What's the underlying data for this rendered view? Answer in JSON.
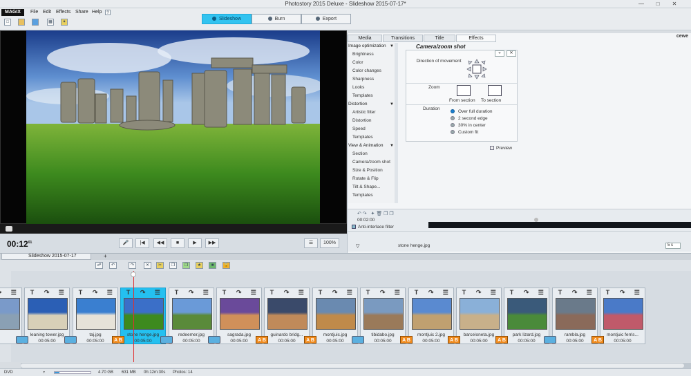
{
  "window": {
    "title": "Photostory 2015 Deluxe - Slideshow 2015-07-17*"
  },
  "menu": {
    "logo": "MAGIX",
    "items": [
      "File",
      "Edit",
      "Effects",
      "Share",
      "Help"
    ]
  },
  "modes": {
    "slideshow": "Slideshow",
    "burn": "Burn",
    "export": "Export"
  },
  "transport": {
    "time": "00:12",
    "frames": "01",
    "zoom": "100%"
  },
  "tabs": {
    "media": "Media",
    "transitions": "Transitions",
    "title": "Title",
    "effects": "Effects",
    "brand": "cewe"
  },
  "categories": {
    "image_opt": "Image optimization",
    "image_opt_items": [
      "Brightness",
      "Color",
      "Color changes",
      "Sharpness",
      "Looks",
      "Templates"
    ],
    "distortion": "Distortion",
    "distortion_items": [
      "Artistic filter",
      "Distortion",
      "Speed",
      "Templates"
    ],
    "view": "View & Animation",
    "view_items": [
      "Section",
      "Camera/zoom shot",
      "Size & Position",
      "Rotate & Flip",
      "Tilt & Shape...",
      "Templates"
    ]
  },
  "camera": {
    "title": "Camera/zoom shot",
    "direction_label": "Direction of movement",
    "zoom_label": "Zoom",
    "from_section": "From section",
    "to_section": "To section",
    "duration_label": "Duration",
    "options": [
      "Over full duration",
      "2 second edge",
      "30% in center",
      "Custom fit"
    ],
    "selected_option": "Over full duration",
    "preview_label": "Preview"
  },
  "panel_bottom": {
    "time": "00:02:00",
    "anti_interlace": "Anti-interlace filter",
    "file": "stone henge.jpg",
    "duration": "5 s"
  },
  "timeline": {
    "tab": "Slideshow 2015-07-17"
  },
  "slides": [
    {
      "name": "",
      "dur": "",
      "partial": true
    },
    {
      "name": "leaning tower.jpg",
      "dur": "00:05:00"
    },
    {
      "name": "taj.jpg",
      "dur": "00:05:00"
    },
    {
      "name": "stone henge.jpg",
      "dur": "00:05:00",
      "selected": true
    },
    {
      "name": "redeemer.jpg",
      "dur": "00:05:00"
    },
    {
      "name": "sagrada.jpg",
      "dur": "00:05:00"
    },
    {
      "name": "guinardo bridg...",
      "dur": "00:05:00"
    },
    {
      "name": "montjuic.jpg",
      "dur": "00:05:00"
    },
    {
      "name": "tibidabo.jpg",
      "dur": "00:05:00"
    },
    {
      "name": "montjuic 2.jpg",
      "dur": "00:05:00"
    },
    {
      "name": "barceloneta.jpg",
      "dur": "00:05:00"
    },
    {
      "name": "park lizard.jpg",
      "dur": "00:05:00"
    },
    {
      "name": "rambla.jpg",
      "dur": "00:05:00"
    },
    {
      "name": "montjuic ferris...",
      "dur": "00:05:00"
    }
  ],
  "status": {
    "medium": "DVD",
    "capacity": "4.70 GB",
    "used": "631 MB",
    "length": "0h:12m:30s",
    "photos": "Photos: 14",
    "progress": 0.13
  },
  "colors": {
    "accent": "#32c3f0",
    "transition_ab": "#f08a1c",
    "playhead": "#e03030"
  }
}
